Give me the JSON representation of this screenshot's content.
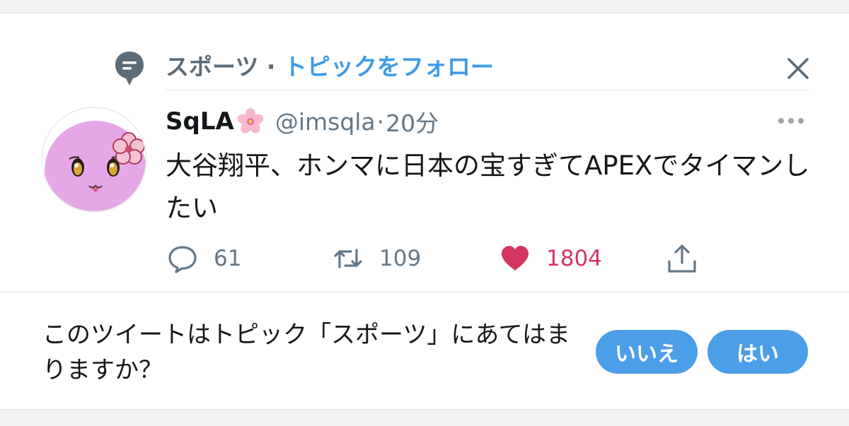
{
  "topic_header": {
    "topic_name": "スポーツ",
    "separator": "·",
    "follow_label": "トピックをフォロー"
  },
  "tweet": {
    "display_name": "SqLA",
    "handle": "@imsqla",
    "dot": "·",
    "time_ago": "20分",
    "text": "大谷翔平、ホンマに日本の宝すぎてAPEXでタイマンしたい"
  },
  "actions": {
    "reply_count": "61",
    "retweet_count": "109",
    "like_count": "1804"
  },
  "prompt": {
    "question": "このツイートはトピック「スポーツ」にあてはまりますか？",
    "no_label": "いいえ",
    "yes_label": "はい"
  },
  "icons": {
    "topic": "topic-speech-bubble-icon",
    "close": "close-icon",
    "more": "more-options-icon",
    "reply": "reply-icon",
    "retweet": "retweet-icon",
    "like": "heart-icon",
    "share": "share-icon",
    "emoji": "cherry-blossom-emoji"
  },
  "colors": {
    "accent_blue": "#3d9be9",
    "button_blue": "#4c9ee8",
    "like_red": "#d3365f",
    "muted_gray": "#657786",
    "text_dark": "#14171a"
  }
}
